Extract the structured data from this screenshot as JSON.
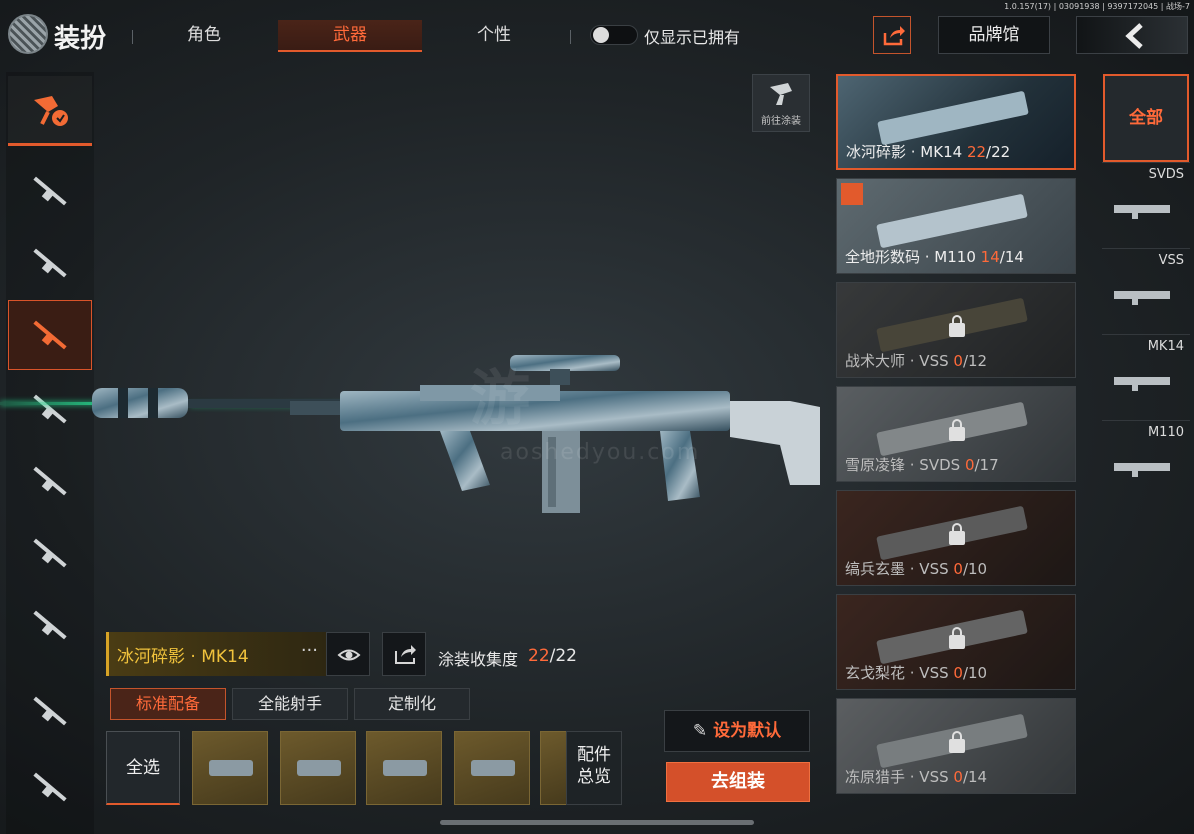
{
  "header": {
    "title": "装扮",
    "tabs": [
      {
        "label": "角色",
        "active": false
      },
      {
        "label": "武器",
        "active": true
      },
      {
        "label": "个性",
        "active": false
      }
    ],
    "toggle_label": "仅显示已拥有",
    "toggle_on": false,
    "brand_label": "品牌馆",
    "version_text": "1.0.157(17) | 03091938 | 9397172045 | 战场-7"
  },
  "left_categories": [
    {
      "icon": "paint-brush-icon",
      "active": false
    },
    {
      "icon": "assault-rifle-icon",
      "active": false
    },
    {
      "icon": "smg-icon",
      "active": false
    },
    {
      "icon": "sniper-rifle-icon",
      "active": true
    },
    {
      "icon": "shotgun-icon",
      "active": false
    },
    {
      "icon": "rifle-icon",
      "active": false
    },
    {
      "icon": "bolt-action-icon",
      "active": false
    },
    {
      "icon": "carbine-icon",
      "active": false
    },
    {
      "icon": "pistol-icon",
      "active": false
    },
    {
      "icon": "melee-icon",
      "active": false
    }
  ],
  "preview": {
    "goto_paint_label": "前往涂装",
    "watermark": "游",
    "watermark_url": "aoshedyou.com"
  },
  "selected_skin": {
    "name": "冰河碎影 · MK14",
    "more": "···",
    "collect_label": "涂装收集度",
    "collect_owned": "22",
    "collect_total": "/22"
  },
  "loadout_tabs": [
    {
      "label": "标准配备",
      "active": true
    },
    {
      "label": "全能射手",
      "active": false
    },
    {
      "label": "定制化",
      "active": false
    }
  ],
  "parts": {
    "select_all": "全选",
    "overview_line1": "配件",
    "overview_line2": "总览"
  },
  "actions": {
    "set_default": "设为默认",
    "assemble": "去组装"
  },
  "skins": [
    {
      "name": "冰河碎影 · MK14",
      "owned": "22",
      "total": "/22",
      "active": true,
      "locked": false
    },
    {
      "name": "全地形数码 · M110",
      "owned": "14",
      "total": "/14",
      "active": false,
      "locked": false
    },
    {
      "name": "战术大师 · VSS",
      "owned": "0",
      "total": "/12",
      "active": false,
      "locked": true
    },
    {
      "name": "雪原凌锋 · SVDS",
      "owned": "0",
      "total": "/17",
      "active": false,
      "locked": true
    },
    {
      "name": "缟兵玄墨 · VSS",
      "owned": "0",
      "total": "/10",
      "active": false,
      "locked": true
    },
    {
      "name": "玄戈梨花 · VSS",
      "owned": "0",
      "total": "/10",
      "active": false,
      "locked": true
    },
    {
      "name": "冻原猎手 · VSS",
      "owned": "0",
      "total": "/14",
      "active": false,
      "locked": true
    }
  ],
  "filters": {
    "all_label": "全部",
    "items": [
      {
        "label": "SVDS"
      },
      {
        "label": "VSS"
      },
      {
        "label": "MK14"
      },
      {
        "label": "M110"
      }
    ]
  },
  "colors": {
    "accent": "#e25a2c",
    "accent_text": "#ff6a3a",
    "gold": "#f0c23c",
    "laser": "#27d38c"
  }
}
